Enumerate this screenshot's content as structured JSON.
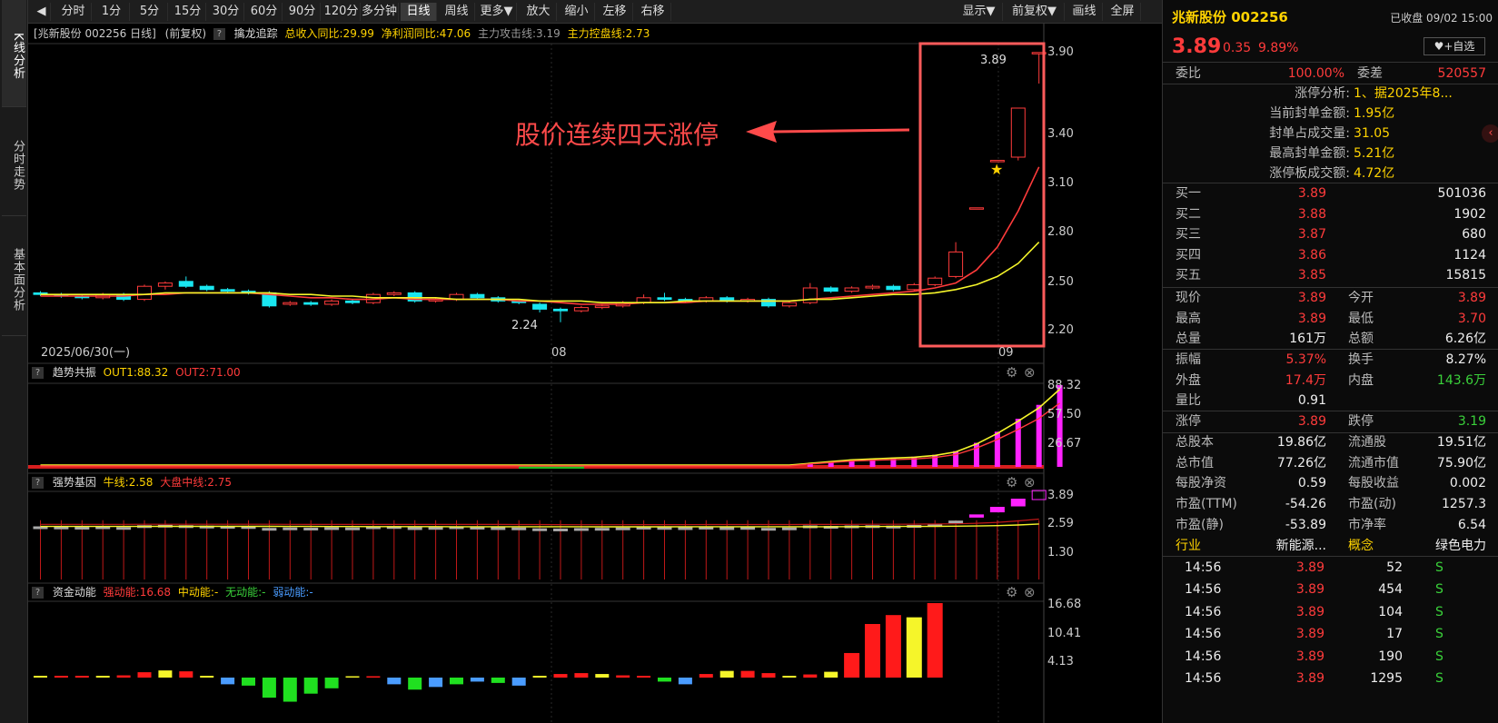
{
  "sidebar": {
    "tabs": [
      "K线分析",
      "分时走势",
      "基本面分析"
    ]
  },
  "toolbar": {
    "back_icon": "left-arrow-icon",
    "periods": [
      "分时",
      "1分",
      "5分",
      "15分",
      "30分",
      "60分",
      "90分",
      "120分",
      "多分钟",
      "日线",
      "周线",
      "更多▼"
    ],
    "active": "日线",
    "actions": [
      "放大",
      "缩小",
      "左移",
      "右移"
    ],
    "right": [
      "显示▼",
      "前复权▼",
      "画线",
      "全屏"
    ]
  },
  "info": {
    "title": "[兆新股份 002256 日线]",
    "adj": "(前复权)",
    "tracker": "擒龙追踪",
    "revenue": "总收入同比:29.99",
    "profit": "净利润同比:47.06",
    "attack": "主力攻击线:3.19",
    "control": "主力控盘线:2.73"
  },
  "kline": {
    "annotation": "股价连续四天涨停",
    "high_label": "3.89",
    "low_label": "2.24",
    "date_left": "2025/06/30(一)",
    "date_mid": "08",
    "date_right": "09",
    "y_ticks": [
      "3.90",
      "3.40",
      "3.10",
      "2.80",
      "2.50",
      "2.20"
    ]
  },
  "panel1": {
    "name": "趋势共振",
    "out1": "OUT1:88.32",
    "out2": "OUT2:71.00",
    "y_ticks": [
      "88.32",
      "57.50",
      "26.67"
    ]
  },
  "panel2": {
    "name": "强势基因",
    "bull": "牛线:2.58",
    "market": "大盘中线:2.75",
    "y_ticks": [
      "3.89",
      "2.59",
      "1.30"
    ]
  },
  "panel3": {
    "name": "资金动能",
    "strong": "强动能:16.68",
    "mid": "中动能:-",
    "none": "无动能:-",
    "weak": "弱动能:-",
    "y_ticks": [
      "16.68",
      "10.41",
      "4.13"
    ]
  },
  "chart_data": {
    "type": "candlestick",
    "title": "兆新股份 002256 日线",
    "ylim": [
      2.2,
      3.9
    ],
    "candles": [
      {
        "o": 2.42,
        "c": 2.41,
        "h": 2.43,
        "l": 2.4
      },
      {
        "o": 2.41,
        "c": 2.4,
        "h": 2.42,
        "l": 2.39
      },
      {
        "o": 2.4,
        "c": 2.39,
        "h": 2.41,
        "l": 2.38
      },
      {
        "o": 2.39,
        "c": 2.41,
        "h": 2.42,
        "l": 2.38
      },
      {
        "o": 2.41,
        "c": 2.38,
        "h": 2.42,
        "l": 2.37
      },
      {
        "o": 2.38,
        "c": 2.46,
        "h": 2.47,
        "l": 2.37
      },
      {
        "o": 2.46,
        "c": 2.48,
        "h": 2.49,
        "l": 2.44
      },
      {
        "o": 2.49,
        "c": 2.46,
        "h": 2.52,
        "l": 2.45
      },
      {
        "o": 2.46,
        "c": 2.44,
        "h": 2.47,
        "l": 2.43
      },
      {
        "o": 2.44,
        "c": 2.43,
        "h": 2.45,
        "l": 2.42
      },
      {
        "o": 2.43,
        "c": 2.42,
        "h": 2.44,
        "l": 2.41
      },
      {
        "o": 2.42,
        "c": 2.34,
        "h": 2.43,
        "l": 2.33
      },
      {
        "o": 2.35,
        "c": 2.36,
        "h": 2.37,
        "l": 2.34
      },
      {
        "o": 2.36,
        "c": 2.35,
        "h": 2.37,
        "l": 2.34
      },
      {
        "o": 2.35,
        "c": 2.37,
        "h": 2.38,
        "l": 2.34
      },
      {
        "o": 2.37,
        "c": 2.36,
        "h": 2.38,
        "l": 2.35
      },
      {
        "o": 2.36,
        "c": 2.41,
        "h": 2.42,
        "l": 2.35
      },
      {
        "o": 2.41,
        "c": 2.42,
        "h": 2.43,
        "l": 2.4
      },
      {
        "o": 2.42,
        "c": 2.37,
        "h": 2.43,
        "l": 2.36
      },
      {
        "o": 2.37,
        "c": 2.38,
        "h": 2.39,
        "l": 2.36
      },
      {
        "o": 2.38,
        "c": 2.41,
        "h": 2.42,
        "l": 2.37
      },
      {
        "o": 2.41,
        "c": 2.39,
        "h": 2.42,
        "l": 2.38
      },
      {
        "o": 2.39,
        "c": 2.37,
        "h": 2.4,
        "l": 2.36
      },
      {
        "o": 2.37,
        "c": 2.36,
        "h": 2.38,
        "l": 2.35
      },
      {
        "o": 2.35,
        "c": 2.32,
        "h": 2.36,
        "l": 2.3
      },
      {
        "o": 2.32,
        "c": 2.31,
        "h": 2.33,
        "l": 2.24
      },
      {
        "o": 2.31,
        "c": 2.33,
        "h": 2.34,
        "l": 2.3
      },
      {
        "o": 2.33,
        "c": 2.34,
        "h": 2.35,
        "l": 2.32
      },
      {
        "o": 2.34,
        "c": 2.36,
        "h": 2.37,
        "l": 2.33
      },
      {
        "o": 2.36,
        "c": 2.39,
        "h": 2.41,
        "l": 2.35
      },
      {
        "o": 2.39,
        "c": 2.38,
        "h": 2.42,
        "l": 2.37
      },
      {
        "o": 2.38,
        "c": 2.37,
        "h": 2.39,
        "l": 2.36
      },
      {
        "o": 2.37,
        "c": 2.39,
        "h": 2.4,
        "l": 2.36
      },
      {
        "o": 2.39,
        "c": 2.37,
        "h": 2.4,
        "l": 2.36
      },
      {
        "o": 2.37,
        "c": 2.38,
        "h": 2.39,
        "l": 2.36
      },
      {
        "o": 2.38,
        "c": 2.34,
        "h": 2.39,
        "l": 2.33
      },
      {
        "o": 2.34,
        "c": 2.36,
        "h": 2.37,
        "l": 2.33
      },
      {
        "o": 2.36,
        "c": 2.45,
        "h": 2.48,
        "l": 2.35
      },
      {
        "o": 2.45,
        "c": 2.43,
        "h": 2.46,
        "l": 2.42
      },
      {
        "o": 2.43,
        "c": 2.45,
        "h": 2.46,
        "l": 2.42
      },
      {
        "o": 2.45,
        "c": 2.46,
        "h": 2.47,
        "l": 2.44
      },
      {
        "o": 2.46,
        "c": 2.44,
        "h": 2.47,
        "l": 2.43
      },
      {
        "o": 2.44,
        "c": 2.47,
        "h": 2.48,
        "l": 2.43
      },
      {
        "o": 2.47,
        "c": 2.51,
        "h": 2.52,
        "l": 2.46
      },
      {
        "o": 2.52,
        "c": 2.67,
        "h": 2.73,
        "l": 2.51
      },
      {
        "o": 2.94,
        "c": 2.94,
        "h": 2.94,
        "l": 2.94
      },
      {
        "o": 3.23,
        "c": 3.23,
        "h": 3.23,
        "l": 3.23
      },
      {
        "o": 3.25,
        "c": 3.55,
        "h": 3.55,
        "l": 3.23
      },
      {
        "o": 3.89,
        "c": 3.89,
        "h": 3.89,
        "l": 3.7
      }
    ],
    "ma_red": [
      2.4,
      2.4,
      2.4,
      2.4,
      2.4,
      2.41,
      2.41,
      2.42,
      2.42,
      2.42,
      2.42,
      2.41,
      2.4,
      2.39,
      2.39,
      2.38,
      2.38,
      2.39,
      2.38,
      2.38,
      2.38,
      2.38,
      2.38,
      2.37,
      2.37,
      2.36,
      2.35,
      2.35,
      2.35,
      2.36,
      2.36,
      2.36,
      2.37,
      2.37,
      2.37,
      2.37,
      2.37,
      2.38,
      2.39,
      2.4,
      2.41,
      2.42,
      2.43,
      2.45,
      2.48,
      2.56,
      2.7,
      2.92,
      3.19
    ],
    "ma_yellow": [
      2.41,
      2.41,
      2.41,
      2.41,
      2.41,
      2.41,
      2.42,
      2.42,
      2.42,
      2.42,
      2.42,
      2.42,
      2.41,
      2.41,
      2.4,
      2.4,
      2.39,
      2.39,
      2.39,
      2.39,
      2.38,
      2.38,
      2.38,
      2.38,
      2.37,
      2.37,
      2.37,
      2.36,
      2.36,
      2.36,
      2.36,
      2.37,
      2.37,
      2.37,
      2.37,
      2.37,
      2.37,
      2.38,
      2.38,
      2.39,
      2.4,
      2.41,
      2.41,
      2.42,
      2.44,
      2.47,
      2.52,
      2.6,
      2.73
    ],
    "trend_bars": [
      0,
      0,
      0,
      0,
      0,
      0,
      0,
      0,
      0,
      0,
      0,
      0,
      0,
      0,
      0,
      0,
      0,
      0,
      0,
      0,
      0,
      0,
      0,
      0,
      0,
      0,
      0,
      0,
      0,
      0,
      0,
      0,
      0,
      0,
      0,
      0,
      0,
      4,
      6,
      8,
      9,
      10,
      11,
      13,
      17,
      26,
      38,
      52,
      67,
      88.32
    ],
    "capital_bars": [
      0.4,
      0.4,
      0.4,
      0.4,
      0.5,
      1.2,
      1.6,
      1.4,
      0.4,
      -0.5,
      -0.6,
      -1.5,
      -1.8,
      -1.2,
      -0.8,
      0,
      0,
      -0.5,
      -0.9,
      -0.7,
      -0.5,
      -0.3,
      -0.4,
      -0.6,
      0.4,
      0.8,
      1.0,
      0.8,
      0.5,
      0.4,
      -0.3,
      -0.5,
      0.8,
      1.5,
      1.5,
      1.0,
      0.4,
      0.7,
      1.3,
      5.5,
      12.0,
      14.0,
      13.5,
      16.68
    ]
  },
  "quote": {
    "name": "兆新股份 002256",
    "status": "已收盘 09/02 15:00",
    "price": "3.89",
    "change": "0.35",
    "pct": "9.89%",
    "watch_label": "+自选",
    "weibi_label": "委比",
    "weibi": "100.00%",
    "weicha_label": "委差",
    "weicha": "520557",
    "analysis": [
      {
        "k": "涨停分析:",
        "v": "1、据2025年8..."
      },
      {
        "k": "当前封单金额:",
        "v": "1.95亿"
      },
      {
        "k": "封单占成交量:",
        "v": "31.05"
      },
      {
        "k": "最高封单金额:",
        "v": "5.21亿"
      },
      {
        "k": "涨停板成交额:",
        "v": "4.72亿"
      }
    ],
    "bids": [
      {
        "k": "买一",
        "p": "3.89",
        "v": "501036"
      },
      {
        "k": "买二",
        "p": "3.88",
        "v": "1902"
      },
      {
        "k": "买三",
        "p": "3.87",
        "v": "680"
      },
      {
        "k": "买四",
        "p": "3.86",
        "v": "1124"
      },
      {
        "k": "买五",
        "p": "3.85",
        "v": "15815"
      }
    ],
    "stats1": [
      {
        "a": "现价",
        "av": "3.89",
        "b": "今开",
        "bv": "3.89"
      },
      {
        "a": "最高",
        "av": "3.89",
        "b": "最低",
        "bv": "3.70"
      },
      {
        "a": "总量",
        "av": "161万",
        "b": "总额",
        "bv": "6.26亿"
      }
    ],
    "stats2": [
      {
        "a": "振幅",
        "av": "5.37%",
        "b": "换手",
        "bv": "8.27%"
      },
      {
        "a": "外盘",
        "av": "17.4万",
        "b": "内盘",
        "bv": "143.6万"
      },
      {
        "a": "量比",
        "av": "0.91",
        "b": "",
        "bv": ""
      }
    ],
    "limit": {
      "a": "涨停",
      "av": "3.89",
      "b": "跌停",
      "bv": "3.19"
    },
    "fundamentals": [
      {
        "a": "总股本",
        "av": "19.86亿",
        "b": "流通股",
        "bv": "19.51亿"
      },
      {
        "a": "总市值",
        "av": "77.26亿",
        "b": "流通市值",
        "bv": "75.90亿"
      },
      {
        "a": "每股净资",
        "av": "0.59",
        "b": "每股收益",
        "bv": "0.002"
      },
      {
        "a": "市盈(TTM)",
        "av": "-54.26",
        "b": "市盈(动)",
        "bv": "1257.3"
      },
      {
        "a": "市盈(静)",
        "av": "-53.89",
        "b": "市净率",
        "bv": "6.54"
      }
    ],
    "industry": {
      "a": "行业",
      "av": "新能源...",
      "b": "概念",
      "bv": "绿色电力"
    },
    "ticks": [
      {
        "t": "14:56",
        "p": "3.89",
        "v": "52",
        "s": "S"
      },
      {
        "t": "14:56",
        "p": "3.89",
        "v": "454",
        "s": "S"
      },
      {
        "t": "14:56",
        "p": "3.89",
        "v": "104",
        "s": "S"
      },
      {
        "t": "14:56",
        "p": "3.89",
        "v": "17",
        "s": "S"
      },
      {
        "t": "14:56",
        "p": "3.89",
        "v": "190",
        "s": "S"
      },
      {
        "t": "14:56",
        "p": "3.89",
        "v": "1295",
        "s": "S"
      }
    ],
    "collapse_icon": "chevron-left-icon"
  }
}
